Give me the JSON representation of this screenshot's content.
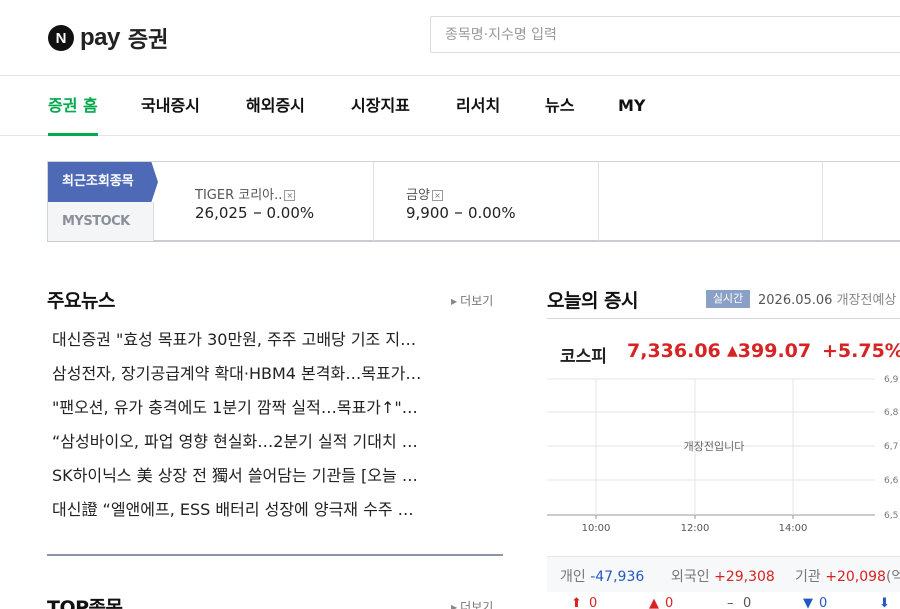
{
  "brand": {
    "logo_letter": "N",
    "logo_pay": "pay",
    "logo_service": "증권"
  },
  "search": {
    "placeholder": "종목명·지수명 입력"
  },
  "nav": [
    "증권 홈",
    "국내증시",
    "해외증시",
    "시장지표",
    "리서치",
    "뉴스",
    "MY"
  ],
  "nav_active": "증권 홈",
  "stockbar": {
    "tab_recent": "최근조회종목",
    "tab_my": "MYSTOCK",
    "close_icon": "×",
    "items": [
      {
        "name": "TIGER 코리아..",
        "price": "26,025",
        "rate": "0.00%"
      },
      {
        "name": "금양",
        "price": "9,900",
        "rate": "0.00%"
      }
    ]
  },
  "news": {
    "title": "주요뉴스",
    "more": "더보기",
    "items": [
      "대신증권 \"효성 목표가 30만원, 주주 고배당 기조 지…",
      "삼성전자, 장기공급계약 확대·HBM4 본격화…목표가…",
      "\"팬오션, 유가 충격에도 1분기 깜짝 실적…목표가↑\"…",
      "“삼성바이오, 파업 영향 현실화…2분기 실적 기대치 …",
      "SK하이닉스 美 상장 전 獨서 쓸어담는 기관들 [오늘 …",
      "대신證 “엘앤에프, ESS 배터리 성장에 양극재 수주 …"
    ]
  },
  "top_stocks": {
    "title": "TOP종목",
    "more": "더보기"
  },
  "market": {
    "title": "오늘의 증시",
    "live_badge": "실시간",
    "date": "2026.05.06",
    "status_note": "개장전예상",
    "index_name": "코스피",
    "index_value": "7,336.06",
    "index_change": "399.07",
    "index_rate": "+5.75%",
    "chart_message": "개장전입니다",
    "x_ticks": [
      "10:00",
      "12:00",
      "14:00"
    ],
    "y_ticks": [
      "6,9",
      "6,8",
      "6,7",
      "6,6",
      "6,5"
    ],
    "investors": [
      {
        "label": "개인",
        "value": "-47,936"
      },
      {
        "label": "외국인",
        "value": "+29,308"
      },
      {
        "label": "기관",
        "value": "+20,098",
        "note": "(억"
      }
    ],
    "bottom_counts": [
      "0",
      "0",
      "0",
      "0"
    ],
    "colors": {
      "up": "#d72323",
      "down": "#2458c3",
      "accent": "#03a94d"
    }
  }
}
